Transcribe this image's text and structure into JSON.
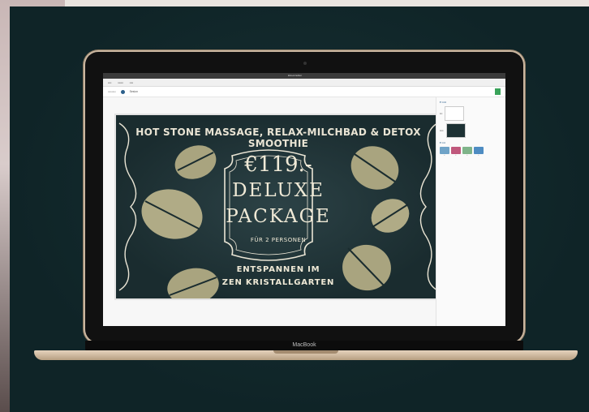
{
  "window": {
    "title": "Ebook Editor"
  },
  "toolbar": {
    "crumb": "Sesion"
  },
  "banner": {
    "headline": "HOT STONE MASSAGE, RELAX-MILCHBAD & DETOX SMOOTHIE",
    "price": "€119.-",
    "title_line1": "DELUXE",
    "title_line2": "PACKAGE",
    "subtitle": "FÜR 2 PERSONEN",
    "footer_line1": "ENTSPANNEN IM",
    "footer_line2": "ZEN KRISTALLGARTEN"
  },
  "laptop": {
    "brand": "MacBook"
  }
}
